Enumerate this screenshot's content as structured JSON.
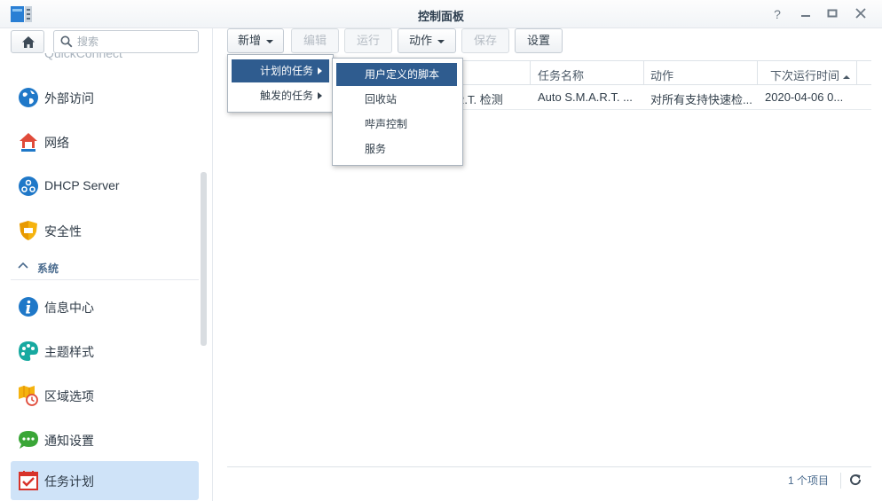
{
  "window": {
    "title": "控制面板"
  },
  "sidebar": {
    "search_placeholder": "搜索",
    "cut_item": "QuickConnect",
    "items": [
      {
        "label": "外部访问",
        "icon": "globe-icon"
      },
      {
        "label": "网络",
        "icon": "network-home-icon"
      },
      {
        "label": "DHCP Server",
        "icon": "dhcp-icon"
      },
      {
        "label": "安全性",
        "icon": "shield-icon"
      },
      {
        "label": "信息中心",
        "icon": "info-icon"
      },
      {
        "label": "主题样式",
        "icon": "palette-icon"
      },
      {
        "label": "区域选项",
        "icon": "region-icon"
      },
      {
        "label": "通知设置",
        "icon": "chat-icon"
      },
      {
        "label": "任务计划",
        "icon": "calendar-check-icon"
      }
    ],
    "section_label": "系统"
  },
  "toolbar": {
    "new_label": "新增",
    "edit_label": "编辑",
    "run_label": "运行",
    "action_label": "动作",
    "save_label": "保存",
    "settings_label": "设置"
  },
  "table": {
    "columns": [
      "任务名称",
      "动作",
      "下次运行时间"
    ],
    "rows": [
      {
        "type": "S.M.A.R.T. 检测",
        "type_visible": "R.T. 检测",
        "name": "Auto S.M.A.R.T. ...",
        "action": "对所有支持快速检...",
        "next_run": "2020-04-06 0..."
      }
    ]
  },
  "footer": {
    "count": "1 个项目"
  },
  "new_menu": {
    "items": [
      "计划的任务",
      "触发的任务"
    ]
  },
  "scheduled_submenu": {
    "items": [
      "用户定义的脚本",
      "回收站",
      "哔声控制",
      "服务"
    ]
  },
  "colors": {
    "accent": "#2f5c8f",
    "selected_nav": "#cfe3f8"
  }
}
